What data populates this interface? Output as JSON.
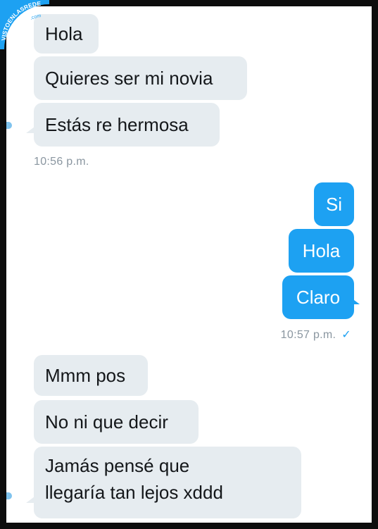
{
  "watermark": {
    "text": "VISTOENLASREDES",
    "suffix": ".com"
  },
  "colors": {
    "incoming_bubble": "#e6ecf0",
    "outgoing_bubble": "#1da1f2",
    "timestamp": "#8a96a0"
  },
  "conversation": {
    "group1": {
      "messages": [
        "Hola",
        "Quieres ser mi novia",
        "Estás re hermosa"
      ],
      "timestamp": "10:56 p.m."
    },
    "group2": {
      "messages": [
        "Si",
        "Hola",
        "Claro"
      ],
      "timestamp": "10:57 p.m.",
      "read_icon": "✓"
    },
    "group3": {
      "messages": [
        "Mmm pos",
        "No ni que decir",
        "Jamás pensé que llegaría tan lejos xddd"
      ]
    }
  }
}
